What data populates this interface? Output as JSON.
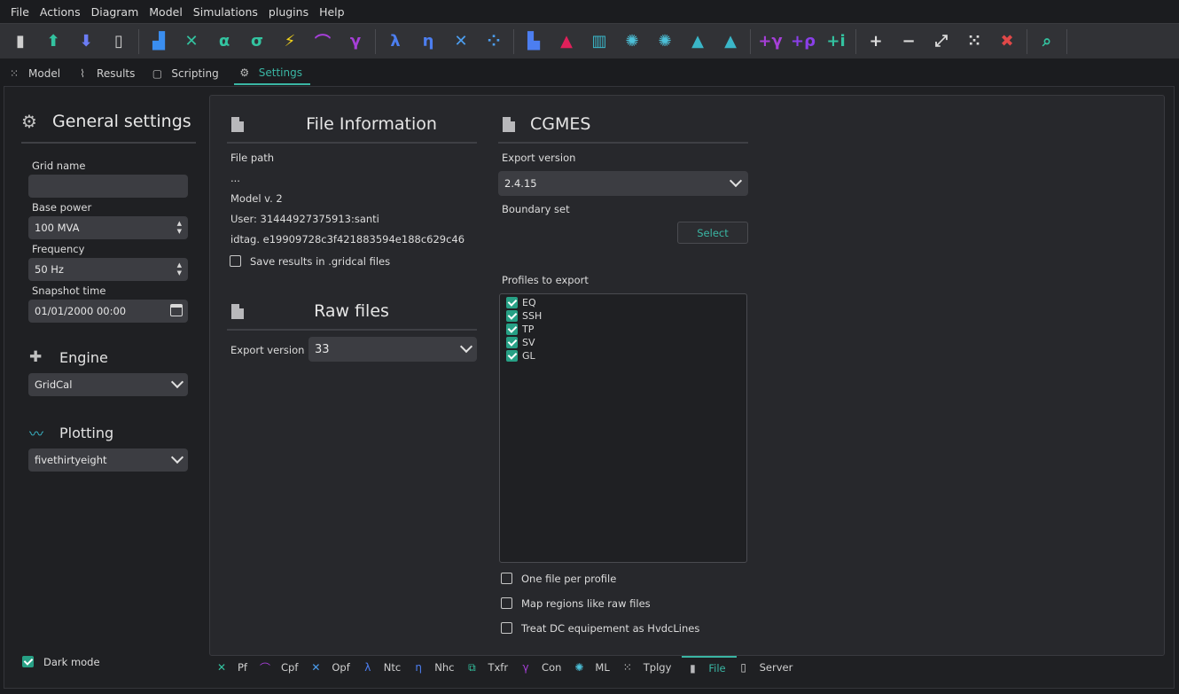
{
  "menu": [
    "File",
    "Actions",
    "Diagram",
    "Model",
    "Simulations",
    "plugins",
    "Help"
  ],
  "toolbar_groups": [
    [
      {
        "icon": "new-file-icon",
        "glyph": "▮",
        "color": "#cfcfcf"
      },
      {
        "icon": "upload-icon",
        "glyph": "⬆",
        "color": "#33c3a0"
      },
      {
        "icon": "download-icon",
        "glyph": "⬇",
        "color": "#6b7cf5"
      },
      {
        "icon": "device-icon",
        "glyph": "▯",
        "color": "#cfcfcf"
      }
    ],
    [
      {
        "icon": "bar-chart-icon",
        "glyph": "▟",
        "color": "#3a8ef0"
      },
      {
        "icon": "power-flow-icon",
        "glyph": "✕",
        "color": "#33c3a0"
      },
      {
        "icon": "alpha-icon",
        "glyph": "α",
        "color": "#33c3a0"
      },
      {
        "icon": "sigma-icon",
        "glyph": "σ",
        "color": "#33c3a0"
      },
      {
        "icon": "lightning-icon",
        "glyph": "⚡",
        "color": "#f2d21b"
      },
      {
        "icon": "curve-icon",
        "glyph": "⌒",
        "color": "#a63fd8"
      },
      {
        "icon": "gamma-icon",
        "glyph": "γ",
        "color": "#a63fd8"
      }
    ],
    [
      {
        "icon": "lambda-icon",
        "glyph": "λ",
        "color": "#4c7ef0"
      },
      {
        "icon": "eta-icon",
        "glyph": "η",
        "color": "#4c7ef0"
      },
      {
        "icon": "network-icon",
        "glyph": "✕",
        "color": "#4c9ef0"
      },
      {
        "icon": "cluster-icon",
        "glyph": "⁘",
        "color": "#4c9ef0"
      }
    ],
    [
      {
        "icon": "histogram-icon",
        "glyph": "▙",
        "color": "#4c7ef0"
      },
      {
        "icon": "peak-icon",
        "glyph": "▲",
        "color": "#e0205a"
      },
      {
        "icon": "columns-icon",
        "glyph": "▥",
        "color": "#3ab6c8"
      },
      {
        "icon": "virus-icon",
        "glyph": "✺",
        "color": "#4cc0d8"
      },
      {
        "icon": "virus-alt-icon",
        "glyph": "✺",
        "color": "#4cc0d8"
      },
      {
        "icon": "area-chart-icon",
        "glyph": "▲",
        "color": "#3ab6c8"
      },
      {
        "icon": "area-chart-alt-icon",
        "glyph": "▲",
        "color": "#3ab6c8"
      }
    ],
    [
      {
        "icon": "add-gamma-icon",
        "glyph": "+γ",
        "color": "#a63fd8"
      },
      {
        "icon": "add-rho-icon",
        "glyph": "+ρ",
        "color": "#8a3fe8"
      },
      {
        "icon": "add-i-icon",
        "glyph": "+i",
        "color": "#33c3a0"
      }
    ],
    [
      {
        "icon": "zoom-in-icon",
        "glyph": "+",
        "color": "#dcdcdc"
      },
      {
        "icon": "zoom-out-icon",
        "glyph": "−",
        "color": "#dcdcdc"
      },
      {
        "icon": "line-tool-icon",
        "glyph": "⤢",
        "color": "#dcdcdc"
      },
      {
        "icon": "dots-tool-icon",
        "glyph": "⁙",
        "color": "#dcdcdc"
      },
      {
        "icon": "delete-dots-icon",
        "glyph": "✖",
        "color": "#e04848"
      }
    ],
    [
      {
        "icon": "inspect-icon",
        "glyph": "⌕",
        "color": "#33c3a0"
      }
    ]
  ],
  "tabs": [
    {
      "label": "Model",
      "icon": "model-icon",
      "glyph": "⁙"
    },
    {
      "label": "Results",
      "icon": "results-icon",
      "glyph": "⌇"
    },
    {
      "label": "Scripting",
      "icon": "scripting-icon",
      "glyph": "▢"
    },
    {
      "label": "Settings",
      "icon": "gear-icon",
      "glyph": "⚙",
      "active": true
    }
  ],
  "general": {
    "title": "General settings",
    "grid_name_label": "Grid name",
    "grid_name_value": "",
    "base_power_label": "Base power",
    "base_power_value": "100 MVA",
    "frequency_label": "Frequency",
    "frequency_value": "50 Hz",
    "snapshot_label": "Snapshot time",
    "snapshot_value": "01/01/2000 00:00",
    "engine_title": "Engine",
    "engine_value": "GridCal",
    "plotting_title": "Plotting",
    "plotting_value": "fivethirtyeight",
    "dark_mode_label": "Dark mode",
    "dark_mode": true
  },
  "file_info": {
    "title": "File Information",
    "path_label": "File path",
    "path_value": "...",
    "model_version": "Model v. 2",
    "user": "User: 31444927375913:santi",
    "idtag": "idtag. e19909728c3f421883594e188c629c46",
    "save_results_label": "Save results in .gridcal files",
    "save_results": false
  },
  "raw_files": {
    "title": "Raw files",
    "export_label": "Export version",
    "export_value": "33"
  },
  "cgmes": {
    "title": "CGMES",
    "export_label": "Export version",
    "export_value": "2.4.15",
    "boundary_label": "Boundary set",
    "select_label": "Select",
    "profiles_label": "Profiles to export",
    "profiles": [
      {
        "name": "EQ",
        "checked": true
      },
      {
        "name": "SSH",
        "checked": true
      },
      {
        "name": "TP",
        "checked": true
      },
      {
        "name": "SV",
        "checked": true
      },
      {
        "name": "GL",
        "checked": true
      }
    ],
    "options": [
      {
        "label": "One file per profile",
        "checked": false
      },
      {
        "label": "Map regions like raw files",
        "checked": false
      },
      {
        "label": "Treat DC equipement as HvdcLines",
        "checked": false
      }
    ]
  },
  "bottom_tabs": [
    {
      "label": "Pf",
      "icon": "pf-icon",
      "glyph": "✕",
      "color": "#33c3a0"
    },
    {
      "label": "Cpf",
      "icon": "cpf-icon",
      "glyph": "⌒",
      "color": "#a63fd8"
    },
    {
      "label": "Opf",
      "icon": "opf-icon",
      "glyph": "✕",
      "color": "#4c9ef0"
    },
    {
      "label": "Ntc",
      "icon": "ntc-icon",
      "glyph": "λ",
      "color": "#4c7ef0"
    },
    {
      "label": "Nhc",
      "icon": "nhc-icon",
      "glyph": "η",
      "color": "#4c7ef0"
    },
    {
      "label": "Txfr",
      "icon": "txfr-icon",
      "glyph": "⧉",
      "color": "#33c3a0"
    },
    {
      "label": "Con",
      "icon": "con-icon",
      "glyph": "γ",
      "color": "#a63fd8"
    },
    {
      "label": "ML",
      "icon": "ml-icon",
      "glyph": "✺",
      "color": "#4cc0d8"
    },
    {
      "label": "Tplgy",
      "icon": "topology-icon",
      "glyph": "⁙",
      "color": "#cfcfcf"
    },
    {
      "label": "File",
      "icon": "file-icon",
      "glyph": "▮",
      "color": "#b8b8bb",
      "active": true
    },
    {
      "label": "Server",
      "icon": "server-icon",
      "glyph": "▯",
      "color": "#cfcfcf"
    }
  ]
}
